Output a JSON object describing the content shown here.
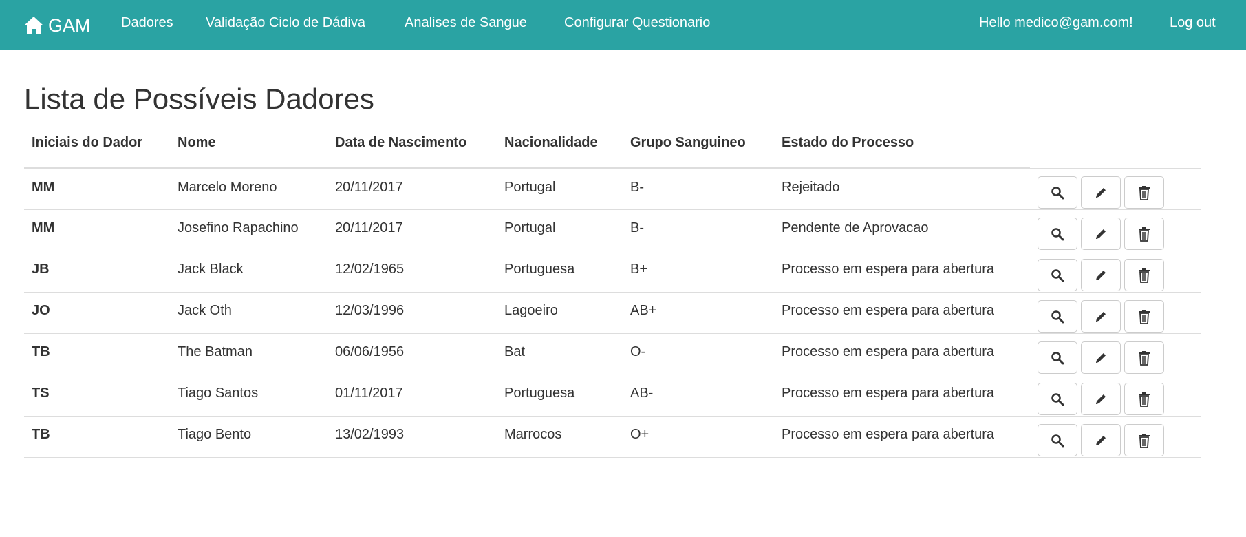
{
  "nav": {
    "brand": "GAM",
    "links": [
      "Dadores",
      "Validação Ciclo de Dádiva",
      "Analises de Sangue",
      "Configurar Questionario"
    ],
    "greeting": "Hello medico@gam.com!",
    "logout": "Log out",
    "bg_color": "#2aa3a3"
  },
  "page": {
    "title": "Lista de Possíveis Dadores"
  },
  "table": {
    "headers": [
      "Iniciais do Dador",
      "Nome",
      "Data de Nascimento",
      "Nacionalidade",
      "Grupo Sanguineo",
      "Estado do Processo"
    ],
    "row_action_icons": [
      "search-icon",
      "pencil-icon",
      "trash-icon"
    ],
    "rows": [
      [
        "MM",
        "Marcelo Moreno",
        "20/11/2017",
        "Portugal",
        "B-",
        "Rejeitado"
      ],
      [
        "MM",
        "Josefino Rapachino",
        "20/11/2017",
        "Portugal",
        "B-",
        "Pendente de Aprovacao"
      ],
      [
        "JB",
        "Jack Black",
        "12/02/1965",
        "Portuguesa",
        "B+",
        "Processo em espera para abertura"
      ],
      [
        "JO",
        "Jack Oth",
        "12/03/1996",
        "Lagoeiro",
        "AB+",
        "Processo em espera para abertura"
      ],
      [
        "TB",
        "The Batman",
        "06/06/1956",
        "Bat",
        "O-",
        "Processo em espera para abertura"
      ],
      [
        "TS",
        "Tiago Santos",
        "01/11/2017",
        "Portuguesa",
        "AB-",
        "Processo em espera para abertura"
      ],
      [
        "TB",
        "Tiago Bento",
        "13/02/1993",
        "Marrocos",
        "O+",
        "Processo em espera para abertura"
      ]
    ]
  }
}
